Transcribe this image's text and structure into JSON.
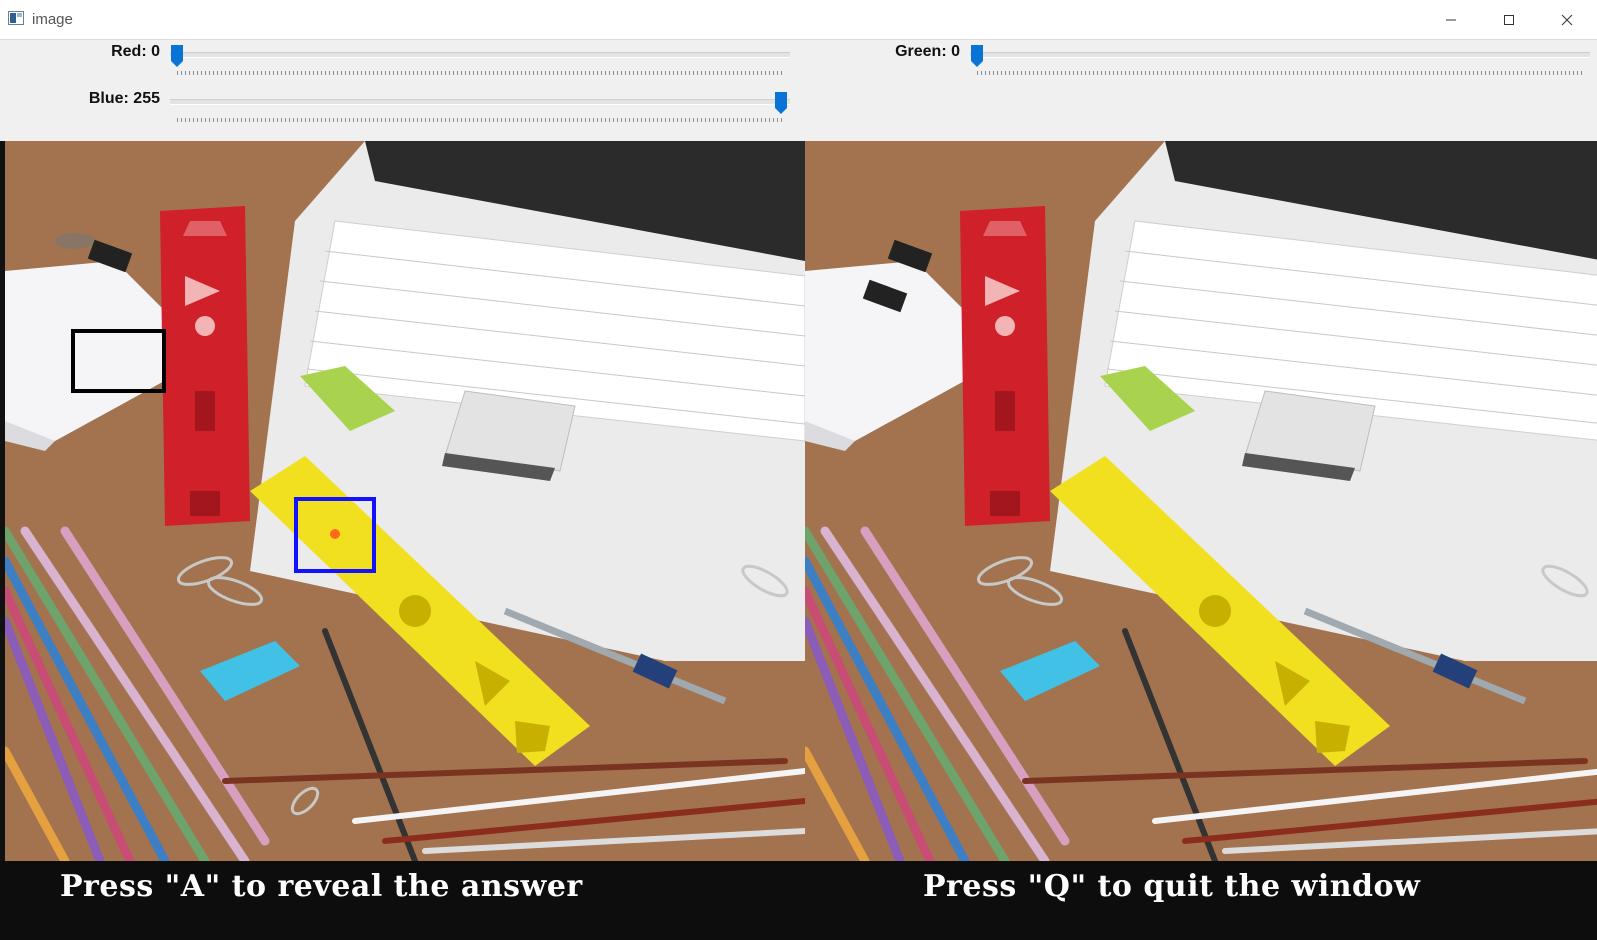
{
  "window": {
    "title": "image",
    "controls": [
      "minimize",
      "maximize",
      "close"
    ]
  },
  "sliders": [
    {
      "id": "red",
      "label": "Red: 0",
      "value": 0,
      "max": 255
    },
    {
      "id": "green",
      "label": "Green: 0",
      "value": 0,
      "max": 255
    },
    {
      "id": "blue",
      "label": "Blue: 255",
      "value": 255,
      "max": 255
    }
  ],
  "captions": {
    "left": "Press \"A\" to reveal the answer",
    "right": "Press \"Q\" to quit the window"
  },
  "colors": {
    "accent": "#0a74d6",
    "marker_black": "#000000",
    "marker_blue": "#1212ff",
    "caption_bg": "#0d0d0d"
  },
  "icons": [
    "app-image-icon",
    "minimize-icon",
    "maximize-icon",
    "close-icon"
  ]
}
